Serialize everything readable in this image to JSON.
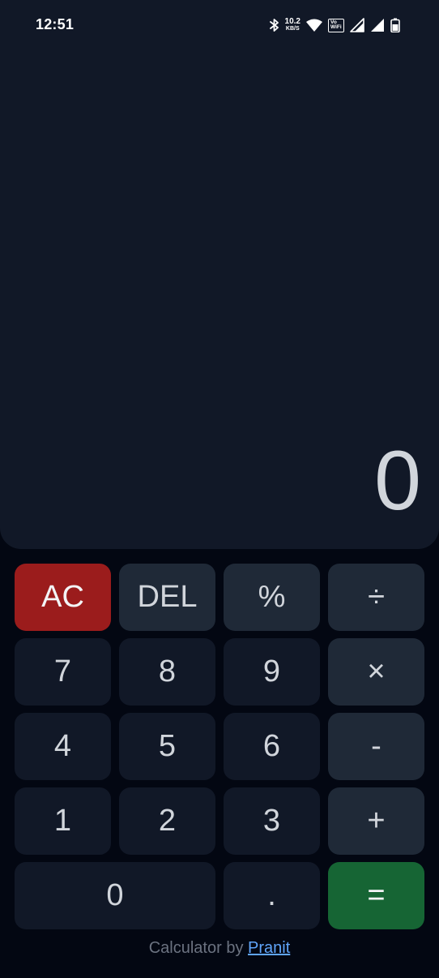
{
  "status_bar": {
    "time": "12:51",
    "net_speed_value": "10.2",
    "net_speed_unit": "KB/S",
    "vowifi_line1": "Vo",
    "vowifi_line2": "WiFi",
    "icons": [
      "bluetooth-icon",
      "wifi-icon",
      "signal-icon",
      "signal-icon",
      "battery-icon"
    ]
  },
  "display": {
    "value": "0"
  },
  "keypad": {
    "keys": [
      "AC",
      "DEL",
      "%",
      "÷",
      "7",
      "8",
      "9",
      "×",
      "4",
      "5",
      "6",
      "-",
      "1",
      "2",
      "3",
      "+",
      "0",
      ".",
      "="
    ]
  },
  "footer": {
    "prefix": "Calculator by ",
    "author": "Pranit"
  },
  "colors": {
    "background": "#030712",
    "display_panel": "#111827",
    "number_key": "#111827",
    "operator_key": "#1f2937",
    "clear_key": "#9b1c1c",
    "equals_key": "#166534",
    "link": "#60a5fa"
  }
}
